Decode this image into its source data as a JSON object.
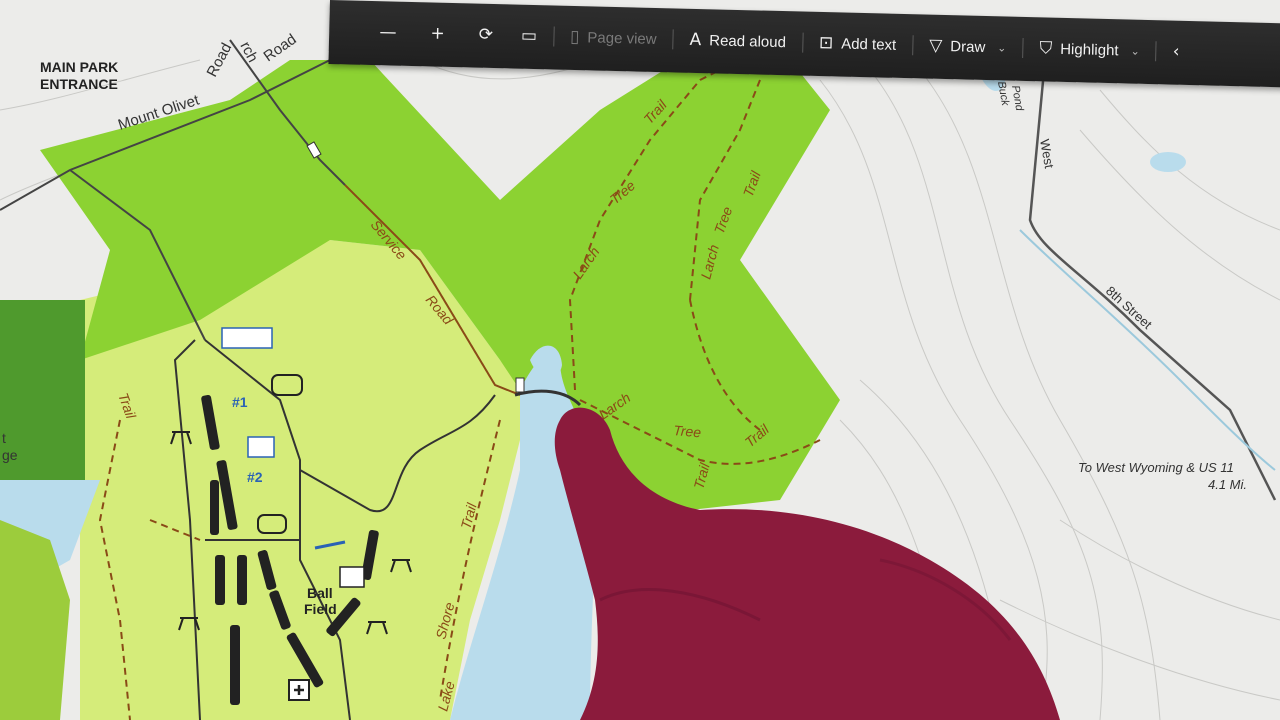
{
  "toolbar": {
    "zoom_out": "—",
    "zoom_in": "+",
    "page_view": "Page view",
    "read_aloud": "Read aloud",
    "add_text": "Add text",
    "draw": "Draw",
    "highlight": "Highlight"
  },
  "map": {
    "main_park_entrance_1": "MAIN PARK",
    "main_park_entrance_2": "ENTRANCE",
    "mount_olivet": "Mount  Olivet",
    "road": "Road",
    "road2": "Road",
    "larch": "rch",
    "service": "Service",
    "service_road": "Road",
    "trail_1": "Trail",
    "tree_1": "Tree",
    "larch_1": "Larch",
    "trail_2": "Trail",
    "tree_2": "Tree",
    "larch_2": "Larch",
    "larch_3": "Larch",
    "tree_3": "Tree",
    "trail_3": "Trail",
    "trail_4": "Trail",
    "trail_left": "Trail",
    "shore": "Shore",
    "trail_shore": "Trail",
    "lake": "Lake",
    "ball_1": "Ball",
    "ball_2": "Field",
    "lot1": "#1",
    "lot2": "#2",
    "west": "West",
    "eighth_street": "8th Street",
    "to_wyoming": "To West Wyoming & US 11",
    "distance": "4.1 Mi.",
    "buck_pond_1": "Buck",
    "buck_pond_2": "Pond",
    "left_edge_1": "t",
    "left_edge_2": "ge"
  },
  "colors": {
    "park_green": "#8cd232",
    "light_green": "#d5ec7a",
    "dark_green": "#4f9a2d",
    "water": "#b9dcec",
    "trail": "#8a4a17",
    "hand": "#8b1b3c"
  }
}
